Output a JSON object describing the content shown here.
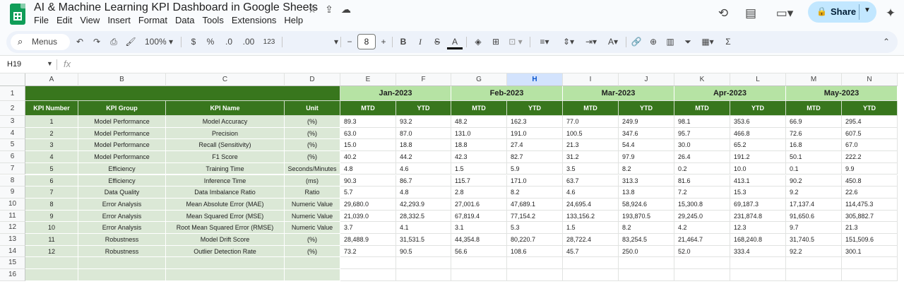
{
  "app": {
    "doc_title": "AI & Machine Learning KPI Dashboard in Google Sheets",
    "menu": [
      "File",
      "Edit",
      "View",
      "Insert",
      "Format",
      "Data",
      "Tools",
      "Extensions",
      "Help"
    ],
    "share_label": "Share",
    "icons": {
      "star": "star-icon",
      "move": "move-to-folder-icon",
      "cloud": "cloud-saved-icon",
      "history": "history-icon",
      "comments": "comment-icon",
      "meet": "video-call-icon",
      "gemini": "gemini-spark-icon"
    }
  },
  "toolbar": {
    "menus_label": "Menus",
    "zoom": "100%",
    "currency": "$",
    "percent": "%",
    "decrease_decimals": ".0",
    "increase_decimals": ".00",
    "number_format": "123",
    "font_size": "8"
  },
  "formula_bar": {
    "name_box": "H19",
    "fx": "fx"
  },
  "grid": {
    "columns": [
      "A",
      "B",
      "C",
      "D",
      "E",
      "F",
      "G",
      "H",
      "I",
      "J",
      "K",
      "L",
      "M",
      "N"
    ],
    "selected_column": "H",
    "row_numbers": [
      "1",
      "2",
      "3",
      "4",
      "5",
      "6",
      "7",
      "8",
      "9",
      "10",
      "11",
      "12",
      "13",
      "14",
      "15",
      "16"
    ],
    "months": [
      "Jan-2023",
      "Feb-2023",
      "Mar-2023",
      "Apr-2023",
      "May-2023"
    ],
    "headers": [
      "KPI Number",
      "KPI Group",
      "KPI Name",
      "Unit"
    ],
    "sub_headers": [
      "MTD",
      "YTD"
    ],
    "rows": [
      {
        "num": "1",
        "group": "Model Performance",
        "name": "Model Accuracy",
        "unit": "(%)",
        "values": [
          "89.3",
          "93.2",
          "48.2",
          "162.3",
          "77.0",
          "249.9",
          "98.1",
          "353.6",
          "66.9",
          "295.4"
        ]
      },
      {
        "num": "2",
        "group": "Model Performance",
        "name": "Precision",
        "unit": "(%)",
        "values": [
          "63.0",
          "87.0",
          "131.0",
          "191.0",
          "100.5",
          "347.6",
          "95.7",
          "466.8",
          "72.6",
          "607.5"
        ]
      },
      {
        "num": "3",
        "group": "Model Performance",
        "name": "Recall (Sensitivity)",
        "unit": "(%)",
        "values": [
          "15.0",
          "18.8",
          "18.8",
          "27.4",
          "21.3",
          "54.4",
          "30.0",
          "65.2",
          "16.8",
          "67.0"
        ]
      },
      {
        "num": "4",
        "group": "Model Performance",
        "name": "F1 Score",
        "unit": "(%)",
        "values": [
          "40.2",
          "44.2",
          "42.3",
          "82.7",
          "31.2",
          "97.9",
          "26.4",
          "191.2",
          "50.1",
          "222.2"
        ]
      },
      {
        "num": "5",
        "group": "Efficiency",
        "name": "Training Time",
        "unit": "Seconds/Minutes",
        "values": [
          "4.8",
          "4.6",
          "1.5",
          "5.9",
          "3.5",
          "8.2",
          "0.2",
          "10.0",
          "0.1",
          "9.9"
        ]
      },
      {
        "num": "6",
        "group": "Efficiency",
        "name": "Inference Time",
        "unit": "(ms)",
        "values": [
          "90.3",
          "86.7",
          "115.7",
          "171.0",
          "63.7",
          "313.3",
          "81.6",
          "413.1",
          "90.2",
          "450.8"
        ]
      },
      {
        "num": "7",
        "group": "Data Quality",
        "name": "Data Imbalance Ratio",
        "unit": "Ratio",
        "values": [
          "5.7",
          "4.8",
          "2.8",
          "8.2",
          "4.6",
          "13.8",
          "7.2",
          "15.3",
          "9.2",
          "22.6"
        ]
      },
      {
        "num": "8",
        "group": "Error Analysis",
        "name": "Mean Absolute Error (MAE)",
        "unit": "Numeric Value",
        "values": [
          "29,680.0",
          "42,293.9",
          "27,001.6",
          "47,689.1",
          "24,695.4",
          "58,924.6",
          "15,300.8",
          "69,187.3",
          "17,137.4",
          "114,475.3"
        ]
      },
      {
        "num": "9",
        "group": "Error Analysis",
        "name": "Mean Squared Error (MSE)",
        "unit": "Numeric Value",
        "values": [
          "21,039.0",
          "28,332.5",
          "67,819.4",
          "77,154.2",
          "133,156.2",
          "193,870.5",
          "29,245.0",
          "231,874.8",
          "91,650.6",
          "305,882.7"
        ]
      },
      {
        "num": "10",
        "group": "Error Analysis",
        "name": "Root Mean Squared Error (RMSE)",
        "unit": "Numeric Value",
        "values": [
          "3.7",
          "4.1",
          "3.1",
          "5.3",
          "1.5",
          "8.2",
          "4.2",
          "12.3",
          "9.7",
          "21.3"
        ]
      },
      {
        "num": "11",
        "group": "Robustness",
        "name": "Model Drift Score",
        "unit": "(%)",
        "values": [
          "28,488.9",
          "31,531.5",
          "44,354.8",
          "80,220.7",
          "28,722.4",
          "83,254.5",
          "21,464.7",
          "168,240.8",
          "31,740.5",
          "151,509.6"
        ]
      },
      {
        "num": "12",
        "group": "Robustness",
        "name": "Outlier Detection Rate",
        "unit": "(%)",
        "values": [
          "73.2",
          "90.5",
          "56.6",
          "108.6",
          "45.7",
          "250.0",
          "52.0",
          "333.4",
          "92.2",
          "300.1"
        ]
      }
    ]
  }
}
